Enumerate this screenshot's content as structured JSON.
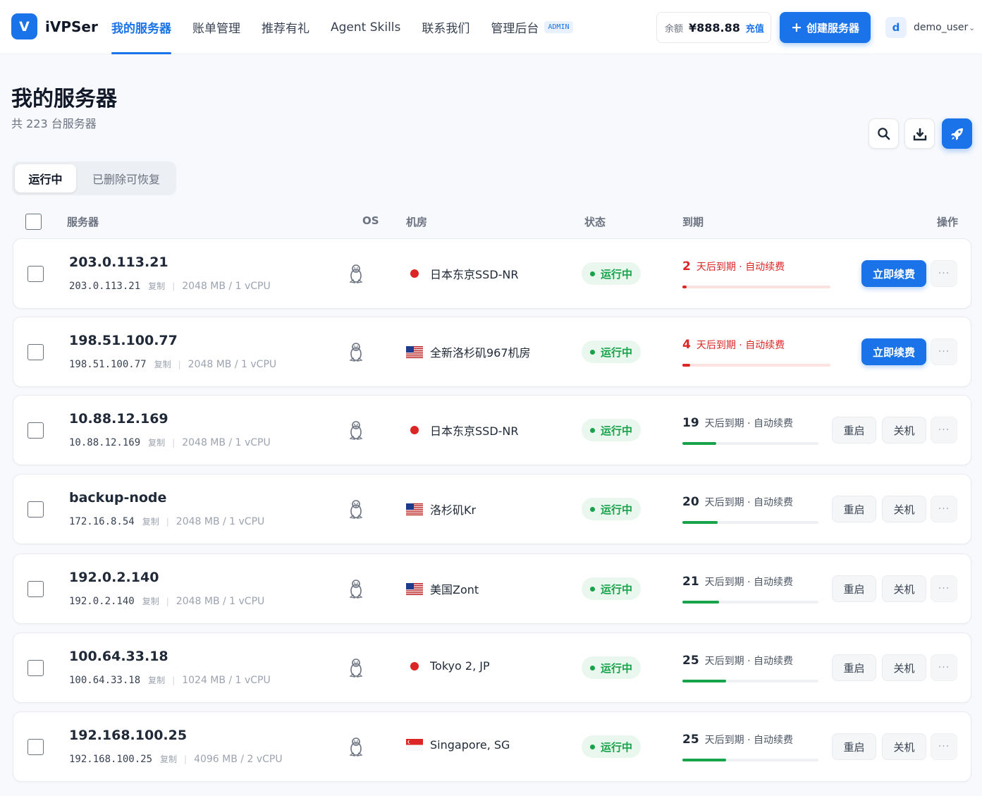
{
  "header": {
    "logo_letter": "V",
    "brand": "iVPSer",
    "nav": [
      {
        "label": "我的服务器",
        "active": true
      },
      {
        "label": "账单管理"
      },
      {
        "label": "推荐有礼"
      },
      {
        "label": "Agent Skills"
      },
      {
        "label": "联系我们"
      },
      {
        "label": "管理后台",
        "badge": "ADMIN"
      }
    ],
    "balance_label": "余额",
    "balance_amount": "¥888.88",
    "recharge_label": "充值",
    "create_label": "创建服务器",
    "user_initial": "d",
    "username": "demo_user"
  },
  "page": {
    "title": "我的服务器",
    "subtitle": "共 223 台服务器"
  },
  "tabs": [
    {
      "label": "运行中",
      "active": true
    },
    {
      "label": "已删除可恢复"
    }
  ],
  "table_headers": {
    "server": "服务器",
    "os": "OS",
    "datacenter": "机房",
    "status": "状态",
    "expire": "到期",
    "actions": "操作"
  },
  "labels": {
    "copy": "复制",
    "expire_suffix": "天后到期 · 自动续费",
    "renew": "立即续费",
    "reboot": "重启",
    "shutdown": "关机",
    "more": "···"
  },
  "colors": {
    "accent": "#1a73e8",
    "running_green": "#16a34a",
    "urgent_red": "#dc2626"
  },
  "servers": [
    {
      "name": "203.0.113.21",
      "ip": "203.0.113.21",
      "spec": "2048 MB / 1 vCPU",
      "os_icon": "linux-tux-icon",
      "flag": "jp",
      "datacenter": "日本东京SSD-NR",
      "status": "运行中",
      "days": "2",
      "urgent": true,
      "progress": 0.03
    },
    {
      "name": "198.51.100.77",
      "ip": "198.51.100.77",
      "spec": "2048 MB / 1 vCPU",
      "os_icon": "linux-tux-icon",
      "flag": "us",
      "datacenter": "全新洛杉矶967机房",
      "status": "运行中",
      "days": "4",
      "urgent": true,
      "progress": 0.05
    },
    {
      "name": "10.88.12.169",
      "ip": "10.88.12.169",
      "spec": "2048 MB / 1 vCPU",
      "os_icon": "linux-tux-icon",
      "flag": "jp",
      "datacenter": "日本东京SSD-NR",
      "status": "运行中",
      "days": "19",
      "urgent": false,
      "progress": 0.25
    },
    {
      "name": "backup-node",
      "ip": "172.16.8.54",
      "spec": "2048 MB / 1 vCPU",
      "os_icon": "linux-tux-icon",
      "flag": "us",
      "datacenter": "洛杉矶Kr",
      "status": "运行中",
      "days": "20",
      "urgent": false,
      "progress": 0.26
    },
    {
      "name": "192.0.2.140",
      "ip": "192.0.2.140",
      "spec": "2048 MB / 1 vCPU",
      "os_icon": "linux-tux-icon",
      "flag": "us",
      "datacenter": "美国Zont",
      "status": "运行中",
      "days": "21",
      "urgent": false,
      "progress": 0.27
    },
    {
      "name": "100.64.33.18",
      "ip": "100.64.33.18",
      "spec": "1024 MB / 1 vCPU",
      "os_icon": "linux-tux-icon",
      "flag": "jp",
      "datacenter": "Tokyo 2, JP",
      "status": "运行中",
      "days": "25",
      "urgent": false,
      "progress": 0.32
    },
    {
      "name": "192.168.100.25",
      "ip": "192.168.100.25",
      "spec": "4096 MB / 2 vCPU",
      "os_icon": "linux-tux-icon",
      "flag": "sg",
      "datacenter": "Singapore, SG",
      "status": "运行中",
      "days": "25",
      "urgent": false,
      "progress": 0.32
    }
  ]
}
